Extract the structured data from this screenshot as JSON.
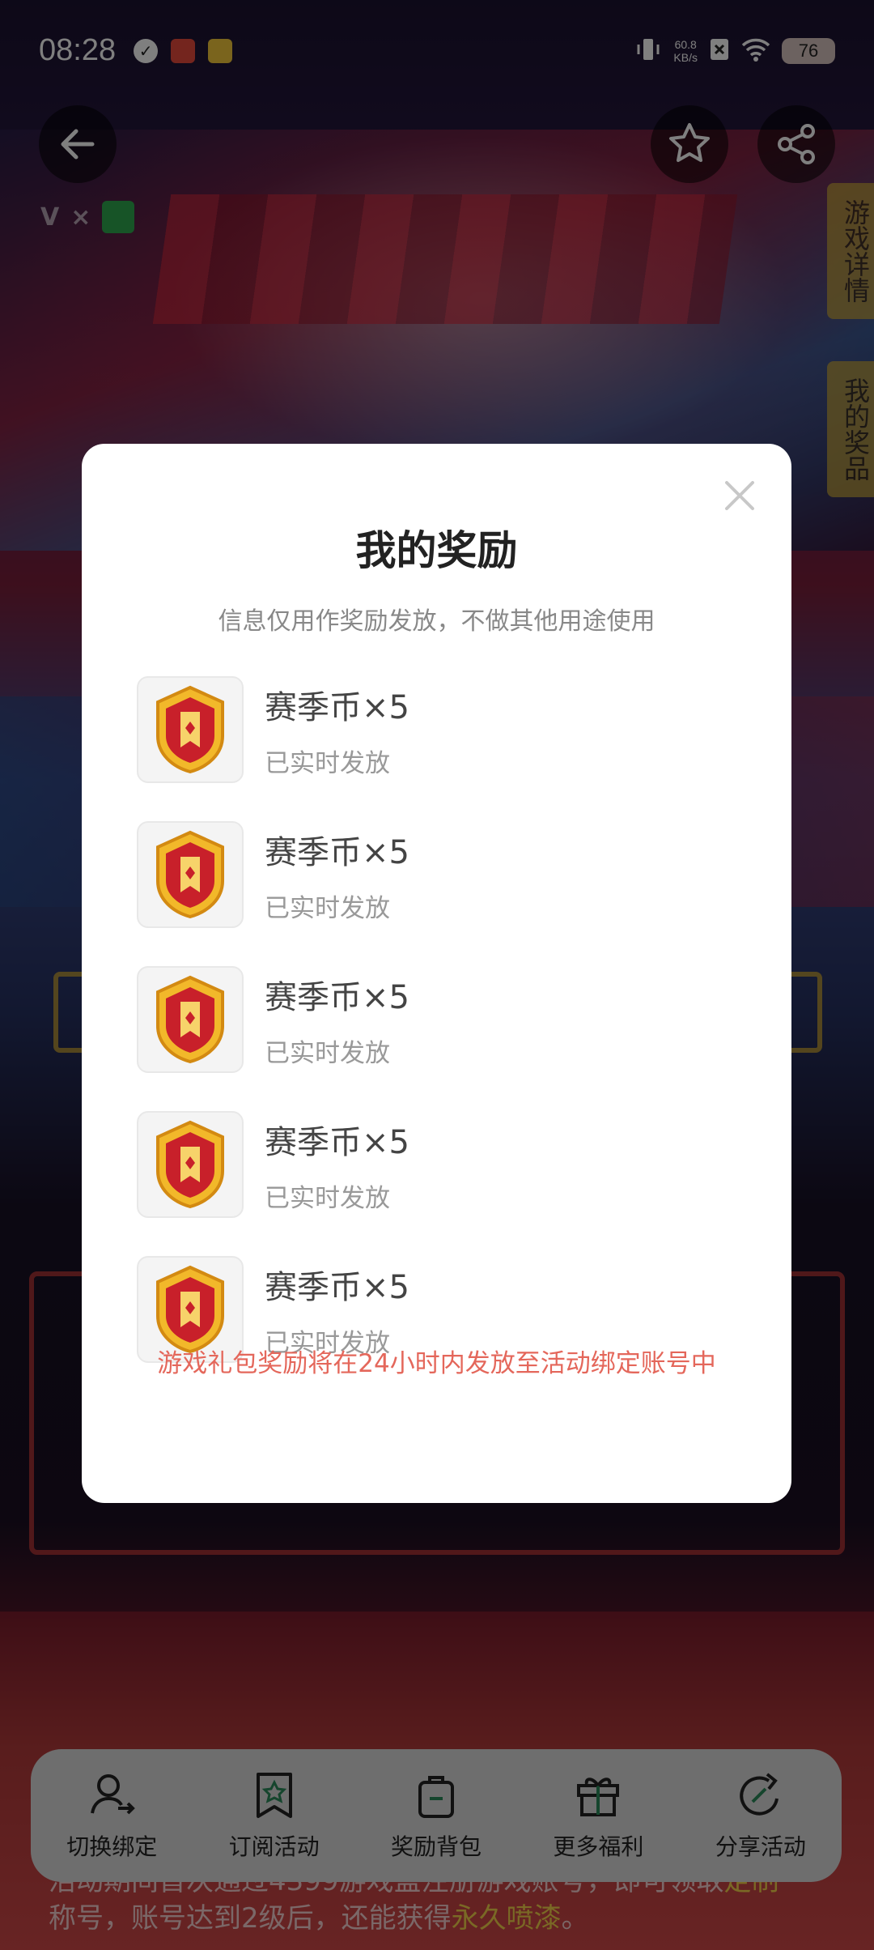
{
  "status_bar": {
    "time": "08:28",
    "net_speed": "60.8",
    "net_unit": "KB/s",
    "battery": "76"
  },
  "side_tabs": {
    "game_detail": "游戏详情",
    "my_prizes": "我的奖品"
  },
  "modal": {
    "title": "我的奖励",
    "subtitle": "信息仅用作奖励发放，不做其他用途使用",
    "items": [
      {
        "name": "赛季币×5",
        "state": "已实时发放",
        "icon": "season-coin-icon"
      },
      {
        "name": "赛季币×5",
        "state": "已实时发放",
        "icon": "season-coin-icon"
      },
      {
        "name": "赛季币×5",
        "state": "已实时发放",
        "icon": "season-coin-icon"
      },
      {
        "name": "赛季币×5",
        "state": "已实时发放",
        "icon": "season-coin-icon"
      },
      {
        "name": "赛季币×5",
        "state": "已实时发放",
        "icon": "season-coin-icon"
      }
    ],
    "notice": "游戏礼包奖励将在24小时内发放至活动绑定账号中"
  },
  "toolbar": {
    "items": [
      {
        "label": "切换绑定",
        "icon": "user-switch-icon"
      },
      {
        "label": "订阅活动",
        "icon": "bookmark-star-icon"
      },
      {
        "label": "奖励背包",
        "icon": "backpack-icon"
      },
      {
        "label": "更多福利",
        "icon": "gift-icon"
      },
      {
        "label": "分享活动",
        "icon": "share-arrow-icon"
      }
    ]
  },
  "footer": {
    "line1_a": "活动期间首次通过4399游戏盒注册游戏账号，即可领取",
    "line1_b": "定制",
    "line2_a": "称号，账号达到2级后，还能获得",
    "line2_b": "永久喷漆",
    "line2_c": "。"
  },
  "colors": {
    "notice": "#e4675b",
    "side_tab": "#c9a73b",
    "toolbar_bg": "#dcdcdc"
  }
}
